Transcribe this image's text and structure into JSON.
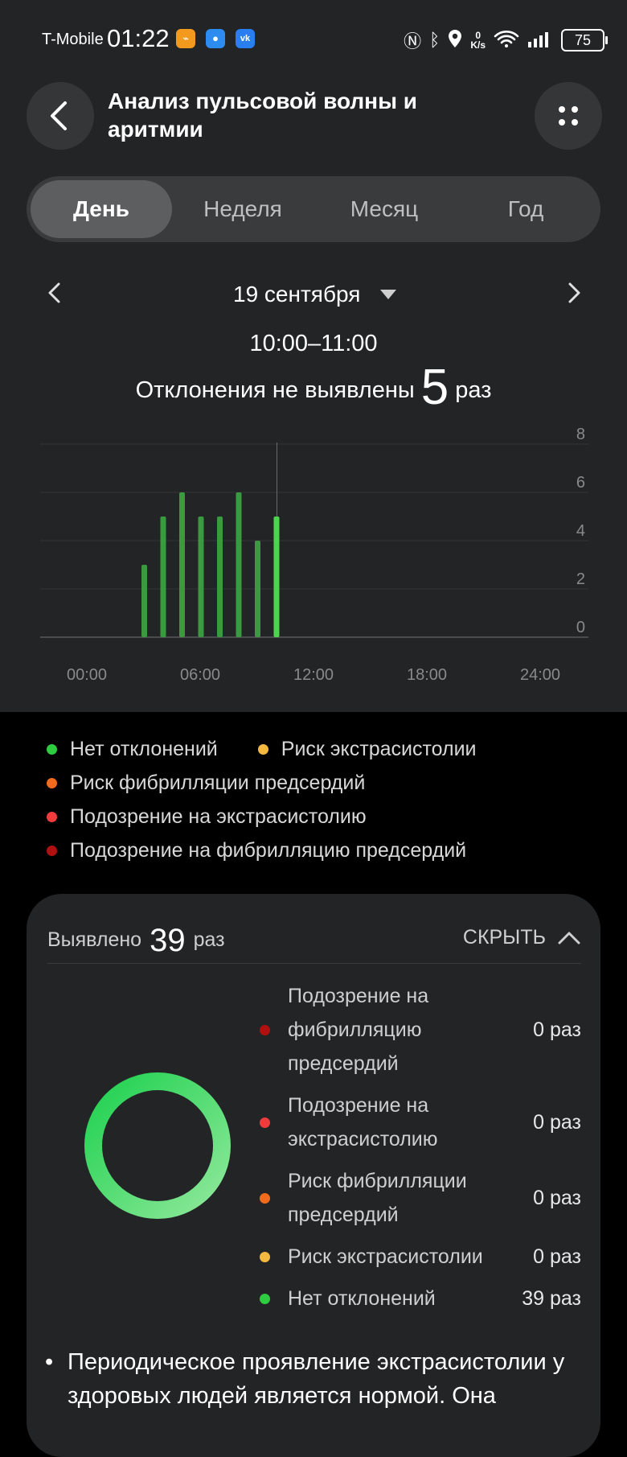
{
  "status_bar": {
    "carrier": "T-Mobile",
    "time": "01:22",
    "network_speed_top": "0",
    "network_speed_bottom": "K/s",
    "battery": "75"
  },
  "header": {
    "title": "Анализ пульсовой волны и аритмии"
  },
  "tabs": [
    {
      "label": "День",
      "active": true
    },
    {
      "label": "Неделя",
      "active": false
    },
    {
      "label": "Месяц",
      "active": false
    },
    {
      "label": "Год",
      "active": false
    }
  ],
  "date_nav": {
    "date": "19 сентября",
    "time_range": "10:00–11:00"
  },
  "summary": {
    "prefix": "Отклонения не выявлены",
    "count": "5",
    "unit": "раз"
  },
  "chart_data": {
    "type": "bar",
    "x_unit": "hour",
    "x": [
      3,
      4,
      5,
      6,
      7,
      8,
      9,
      10
    ],
    "values": [
      3,
      5,
      6,
      5,
      5,
      6,
      4,
      5
    ],
    "selected_x": 10,
    "x_ticks": [
      "00:00",
      "06:00",
      "12:00",
      "18:00",
      "24:00"
    ],
    "xlim": [
      0,
      24
    ],
    "y_ticks": [
      "0",
      "2",
      "4",
      "6",
      "8"
    ],
    "ylim": [
      0,
      8
    ],
    "grid": true,
    "bar_color": "#3a9a3f",
    "selected_color": "#4cd44f"
  },
  "legend": [
    {
      "label": "Нет отклонений",
      "color": "#2ecc40"
    },
    {
      "label": "Риск экстрасистолии",
      "color": "#f5b942"
    },
    {
      "label": "Риск фибрилляции предсердий",
      "color": "#f26b1d"
    },
    {
      "label": "Подозрение на экстрасистолию",
      "color": "#f03c3c"
    },
    {
      "label": "Подозрение на фибрилляцию предсердий",
      "color": "#b01010"
    }
  ],
  "card": {
    "detected_label": "Выявлено",
    "detected_count": "39",
    "detected_unit": "раз",
    "hide_label": "СКРЫТЬ",
    "breakdown": [
      {
        "label": "Подозрение на фибрилляцию предсердий",
        "count": "0 раз",
        "color": "#b01010"
      },
      {
        "label": "Подозрение на экстрасистолию",
        "count": "0 раз",
        "color": "#f03c3c"
      },
      {
        "label": "Риск фибрилляции предсердий",
        "count": "0 раз",
        "color": "#f26b1d"
      },
      {
        "label": "Риск экстрасистолии",
        "count": "0 раз",
        "color": "#f5b942"
      },
      {
        "label": "Нет отклонений",
        "count": "39 раз",
        "color": "#2ecc40"
      }
    ],
    "note": "Периодическое проявление экстрасистолии у здоровых людей является нормой. Она"
  }
}
